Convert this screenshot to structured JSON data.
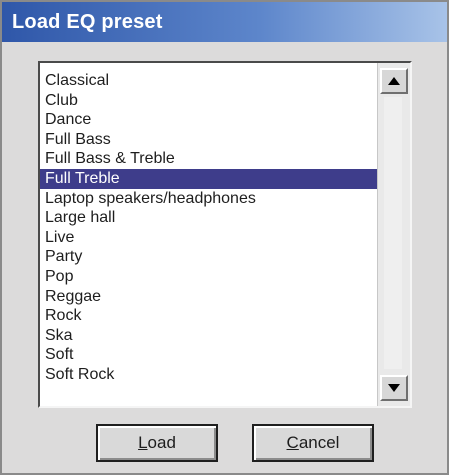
{
  "window": {
    "title": "Load EQ preset"
  },
  "preset_list": {
    "items": [
      {
        "label": "Classical",
        "selected": false
      },
      {
        "label": "Club",
        "selected": false
      },
      {
        "label": "Dance",
        "selected": false
      },
      {
        "label": "Full Bass",
        "selected": false
      },
      {
        "label": "Full Bass & Treble",
        "selected": false
      },
      {
        "label": "Full Treble",
        "selected": true
      },
      {
        "label": "Laptop speakers/headphones",
        "selected": false
      },
      {
        "label": "Large hall",
        "selected": false
      },
      {
        "label": "Live",
        "selected": false
      },
      {
        "label": "Party",
        "selected": false
      },
      {
        "label": "Pop",
        "selected": false
      },
      {
        "label": "Reggae",
        "selected": false
      },
      {
        "label": "Rock",
        "selected": false
      },
      {
        "label": "Ska",
        "selected": false
      },
      {
        "label": "Soft",
        "selected": false
      },
      {
        "label": "Soft Rock",
        "selected": false
      }
    ],
    "selected_index": 5
  },
  "buttons": {
    "load_label": "Load",
    "cancel_label": "Cancel"
  },
  "icons": {
    "scroll_up": "triangle-up-icon",
    "scroll_down": "triangle-down-icon"
  },
  "colors": {
    "titlebar_start": "#2f57a9",
    "titlebar_end": "#a8c3e8",
    "selection_bg": "#3e3d8b",
    "selection_text": "#ffffff",
    "dialog_bg": "#dcdbdb"
  }
}
